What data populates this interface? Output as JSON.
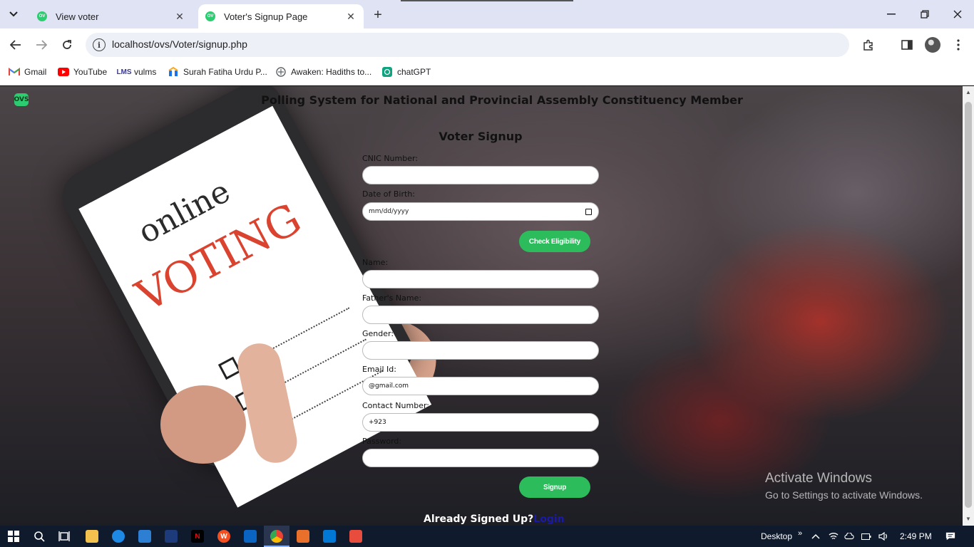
{
  "browser": {
    "tabs": [
      {
        "title": "View voter"
      },
      {
        "title": "Voter's Signup Page"
      }
    ],
    "url": "localhost/ovs/Voter/signup.php",
    "bookmarks": [
      {
        "label": "Gmail",
        "icon": "gmail-icon"
      },
      {
        "label": "YouTube",
        "icon": "youtube-icon"
      },
      {
        "label": "vulms",
        "icon": "vulms-icon"
      },
      {
        "label": "Surah Fatiha Urdu P...",
        "icon": "bookmark-site-icon"
      },
      {
        "label": "Awaken: Hadiths to...",
        "icon": "awaken-icon"
      },
      {
        "label": "chatGPT",
        "icon": "chatgpt-icon"
      }
    ]
  },
  "page": {
    "logo_text": "OVS",
    "heading": "Polling System for National and Provincial Assembly Constituency Member",
    "illustration": {
      "line1": "online",
      "line2": "VOTING"
    },
    "form": {
      "title": "Voter Signup",
      "cnic_label": "CNIC Number:",
      "cnic_value": "",
      "dob_label": "Date of Birth:",
      "dob_placeholder": "mm/dd/yyyy",
      "check_button": "Check Eligibility",
      "name_label": "Name:",
      "name_value": "",
      "father_label": "Father's Name:",
      "father_value": "",
      "gender_label": "Gender:",
      "gender_value": "",
      "email_label": "Email Id:",
      "email_value": "@gmail.com",
      "contact_label": "Contact Number:",
      "contact_value": "+923",
      "password_label": "Password:",
      "password_value": "",
      "signup_button": "Signup",
      "already_text": "Already Signed Up?",
      "login_link": "Login"
    },
    "watermark": {
      "line1": "Activate Windows",
      "line2": "Go to Settings to activate Windows."
    }
  },
  "taskbar": {
    "desktop_label": "Desktop",
    "time": "2:49 PM"
  },
  "colors": {
    "accent_green": "#2dbc5c",
    "login_link": "#1a1aa8"
  }
}
